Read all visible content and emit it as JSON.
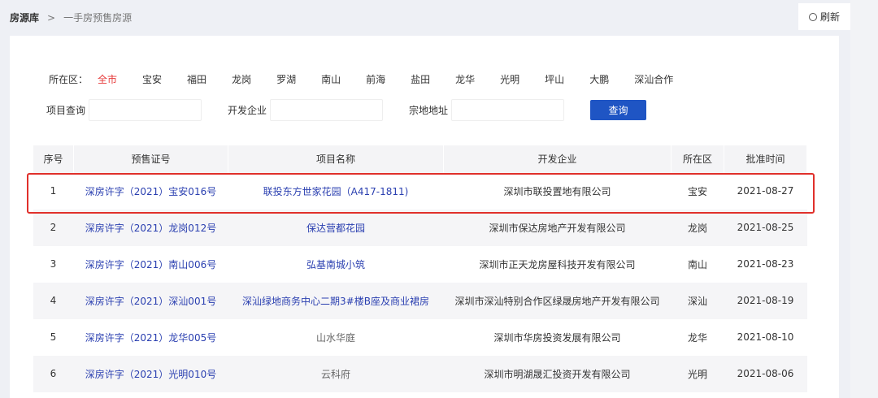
{
  "breadcrumb": {
    "root": "房源库",
    "sep": ">",
    "current": "一手房预售房源"
  },
  "refresh_label": "刷新",
  "filter": {
    "label": "所在区：",
    "districts": [
      "全市",
      "宝安",
      "福田",
      "龙岗",
      "罗湖",
      "南山",
      "前海",
      "盐田",
      "龙华",
      "光明",
      "坪山",
      "大鹏",
      "深汕合作"
    ],
    "active": "全市"
  },
  "search": {
    "project_label": "项目查询",
    "project_value": "",
    "developer_label": "开发企业",
    "developer_value": "",
    "address_label": "宗地地址",
    "address_value": "",
    "button": "查询"
  },
  "table": {
    "headers": [
      "序号",
      "预售证号",
      "项目名称",
      "开发企业",
      "所在区",
      "批准时间"
    ],
    "rows": [
      [
        "1",
        "深房许字（2021）宝安016号",
        "联投东方世家花园（A417-1811)",
        "深圳市联投置地有限公司",
        "宝安",
        "2021-08-27"
      ],
      [
        "2",
        "深房许字（2021）龙岗012号",
        "保达营都花园",
        "深圳市保达房地产开发有限公司",
        "龙岗",
        "2021-08-25"
      ],
      [
        "3",
        "深房许字（2021）南山006号",
        "弘基南城小筑",
        "深圳市正天龙房屋科技开发有限公司",
        "南山",
        "2021-08-23"
      ],
      [
        "4",
        "深房许字（2021）深汕001号",
        "深汕绿地商务中心二期3#楼B座及商业裙房",
        "深圳市深汕特别合作区绿晟房地产开发有限公司",
        "深汕",
        "2021-08-19"
      ],
      [
        "5",
        "深房许字（2021）龙华005号",
        "山水华庭",
        "深圳市华房投资发展有限公司",
        "龙华",
        "2021-08-10"
      ],
      [
        "6",
        "深房许字（2021）光明010号",
        "云科府",
        "深圳市明湖晟汇投资开发有限公司",
        "光明",
        "2021-08-06"
      ]
    ]
  },
  "colors": {
    "accent": "#1f55c4",
    "active": "#e63a3a",
    "highlight": "#e0302b",
    "link": "#2a3fb0"
  }
}
